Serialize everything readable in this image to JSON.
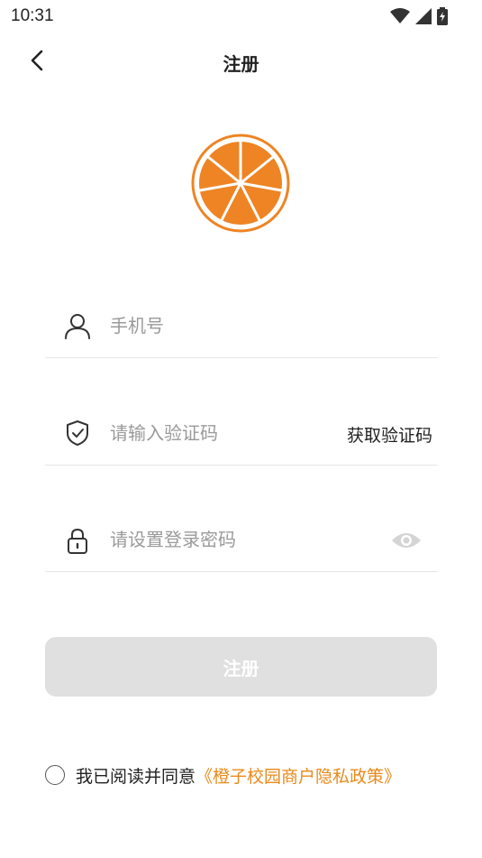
{
  "status_bar": {
    "time": "10:31"
  },
  "nav": {
    "title": "注册"
  },
  "form": {
    "phone": {
      "placeholder": "手机号",
      "icon": "user-icon"
    },
    "code": {
      "placeholder": "请输入验证码",
      "icon": "shield-check-icon",
      "button_label": "获取验证码"
    },
    "password": {
      "placeholder": "请设置登录密码",
      "icon": "lock-icon",
      "toggle_icon": "eye-icon"
    },
    "submit_label": "注册"
  },
  "agreement": {
    "text": "我已阅读并同意",
    "link": "《橙子校园商户隐私政策》"
  },
  "colors": {
    "accent": "#e98a1b",
    "logo_fill": "#ee8424",
    "disabled_button": "#e0e0e0"
  }
}
